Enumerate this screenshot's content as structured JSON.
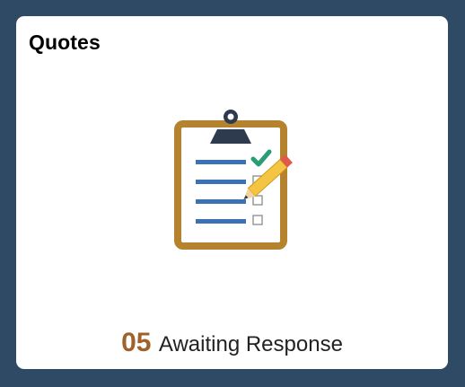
{
  "tile": {
    "title": "Quotes",
    "icon": "clipboard-checklist-icon",
    "count": "05",
    "status_text": "Awaiting Response"
  },
  "colors": {
    "background": "#2f4a64",
    "tile_background": "#ffffff",
    "count": "#a0622b",
    "clipboard_frame": "#b5822e",
    "clip": "#2e3a4d",
    "list_lines": "#3a72b4",
    "checkmark": "#2a9d74",
    "pencil": "#f4c542"
  }
}
